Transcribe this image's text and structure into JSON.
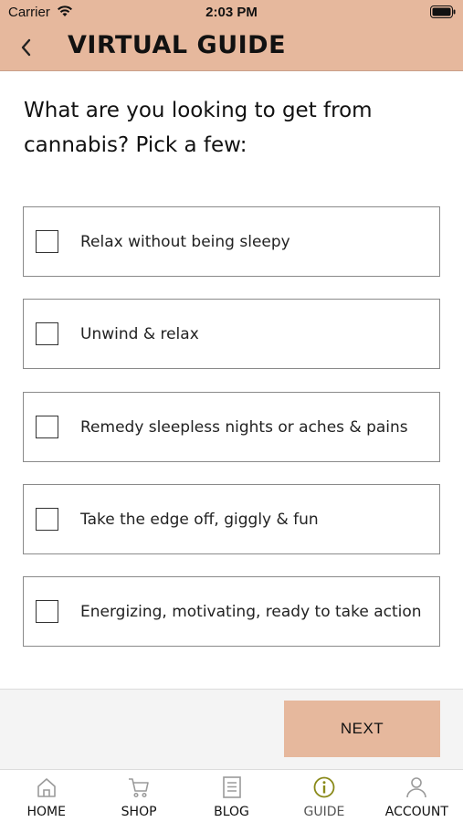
{
  "status_bar": {
    "carrier": "Carrier",
    "time": "2:03 PM"
  },
  "header": {
    "title": "VIRTUAL GUIDE"
  },
  "question": "What are you looking to get from cannabis? Pick a few:",
  "options": [
    {
      "label": "Relax without being sleepy",
      "checked": false
    },
    {
      "label": "Unwind & relax",
      "checked": false
    },
    {
      "label": "Remedy sleepless nights or aches & pains",
      "checked": false
    },
    {
      "label": "Take the edge off, giggly & fun",
      "checked": false
    },
    {
      "label": "Energizing, motivating, ready to take action",
      "checked": false
    }
  ],
  "next_label": "NEXT",
  "tabs": [
    {
      "label": "HOME",
      "icon": "home-icon"
    },
    {
      "label": "SHOP",
      "icon": "cart-icon"
    },
    {
      "label": "BLOG",
      "icon": "document-icon"
    },
    {
      "label": "GUIDE",
      "icon": "info-icon",
      "active": true
    },
    {
      "label": "ACCOUNT",
      "icon": "person-icon"
    }
  ],
  "colors": {
    "accent": "#e6b89d",
    "active_tab": "#8a8a1a",
    "inactive_tab": "#9a9a9a"
  }
}
